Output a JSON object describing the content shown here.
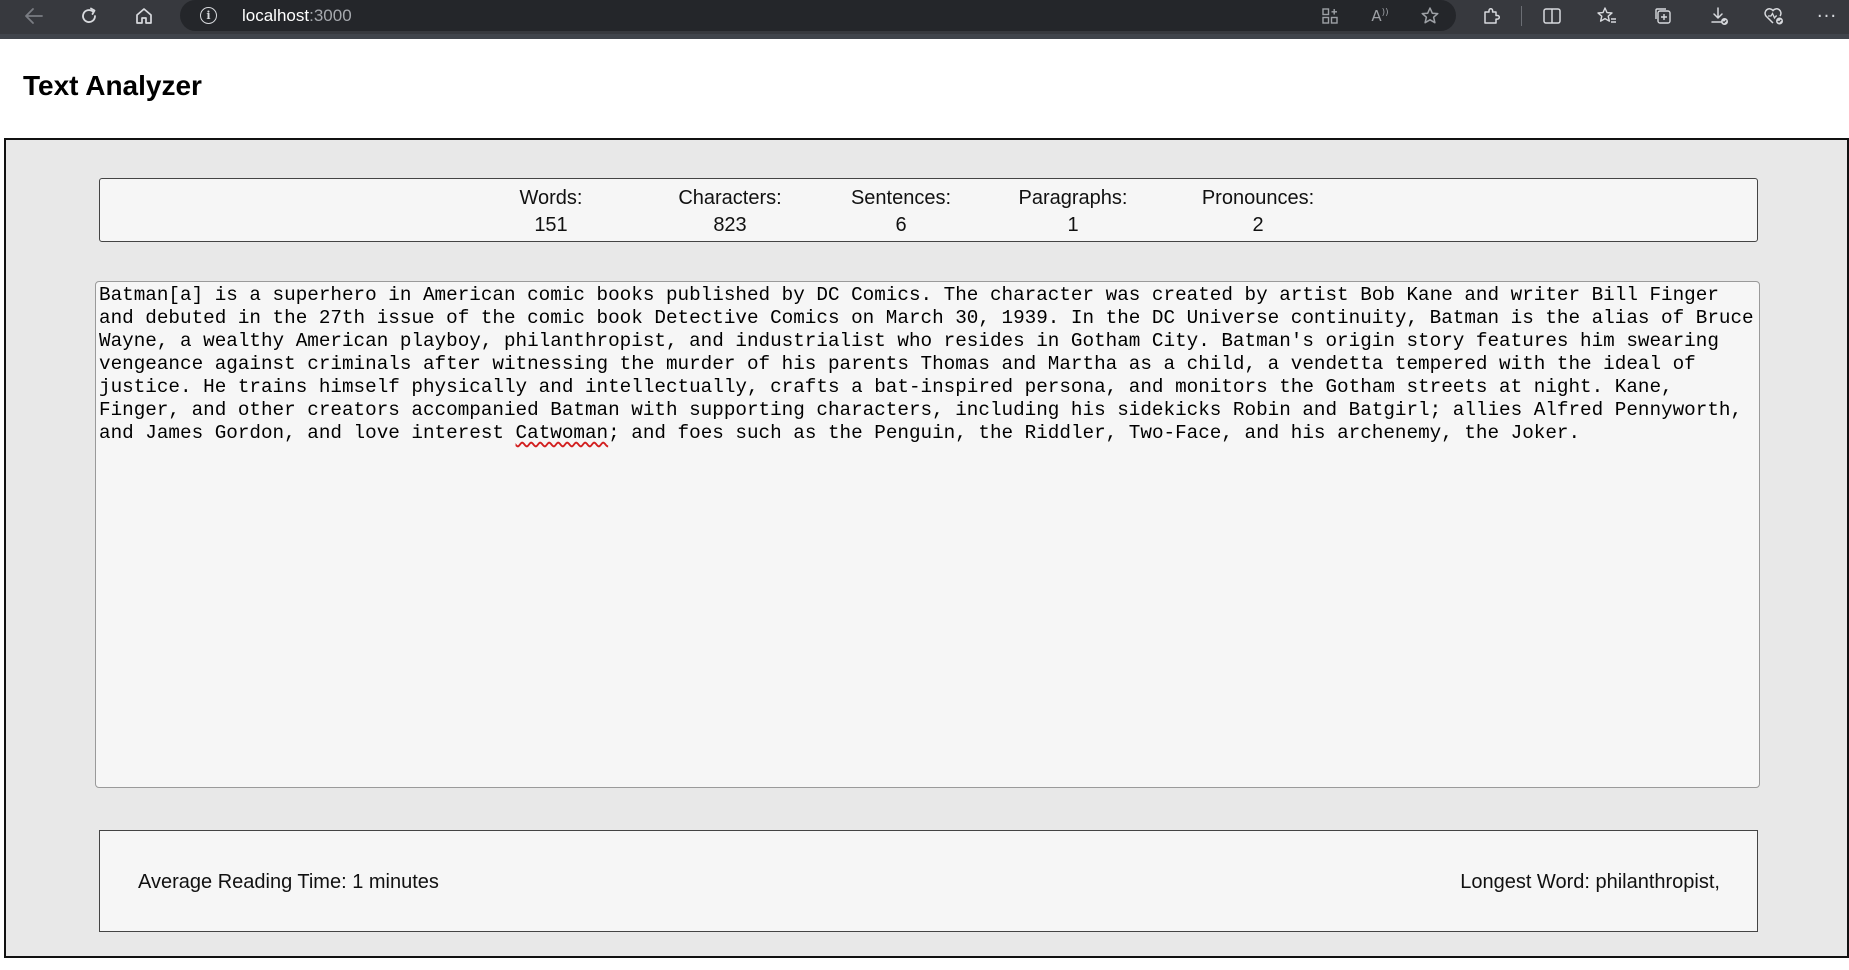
{
  "browser": {
    "url_host": "localhost",
    "url_port": ":3000",
    "icons": {
      "back": "arrow-left-icon",
      "reload": "refresh-icon",
      "home": "home-icon",
      "info": "info-icon",
      "apps": "grid-plus-icon",
      "read_aloud": "read-aloud-icon",
      "favorite": "star-icon",
      "extensions": "puzzle-icon",
      "split_screen": "split-screen-icon",
      "favorites": "favorites-list-icon",
      "collections": "collections-icon",
      "downloads": "download-icon",
      "browser_essentials": "heart-pulse-icon",
      "more": "more-icon"
    }
  },
  "app": {
    "title": "Text Analyzer"
  },
  "stats": [
    {
      "label": "Words:",
      "value": "151"
    },
    {
      "label": "Characters:",
      "value": "823"
    },
    {
      "label": "Sentences:",
      "value": "6"
    },
    {
      "label": "Paragraphs:",
      "value": "1"
    },
    {
      "label": "Pronounces:",
      "value": "2"
    }
  ],
  "editor": {
    "text_before_misspelling": "Batman[a] is a superhero in American comic books published by DC Comics. The character was created by artist Bob Kane and writer Bill Finger and debuted in the 27th issue of the comic book Detective Comics on March 30, 1939. In the DC Universe continuity, Batman is the alias of Bruce Wayne, a wealthy American playboy, philanthropist, and industrialist who resides in Gotham City. Batman's origin story features him swearing vengeance against criminals after witnessing the murder of his parents Thomas and Martha as a child, a vendetta tempered with the ideal of justice. He trains himself physically and intellectually, crafts a bat-inspired persona, and monitors the Gotham streets at night. Kane, Finger, and other creators accompanied Batman with supporting characters, including his sidekicks Robin and Batgirl; allies Alfred Pennyworth, and James Gordon, and love interest ",
    "misspelled_word": "Catwoman",
    "text_after_misspelling": "; and foes such as the Penguin, the Riddler, Two-Face, and his archenemy, the Joker."
  },
  "summary": {
    "reading_time": "Average Reading Time: 1 minutes",
    "longest_word": "Longest Word: philanthropist,"
  },
  "colors": {
    "chrome_bg": "#37393e",
    "address_bg": "#24262a",
    "panel_bg": "#e8e8e8",
    "box_bg": "#f6f6f6",
    "spellcheck": "#d21f1f"
  }
}
